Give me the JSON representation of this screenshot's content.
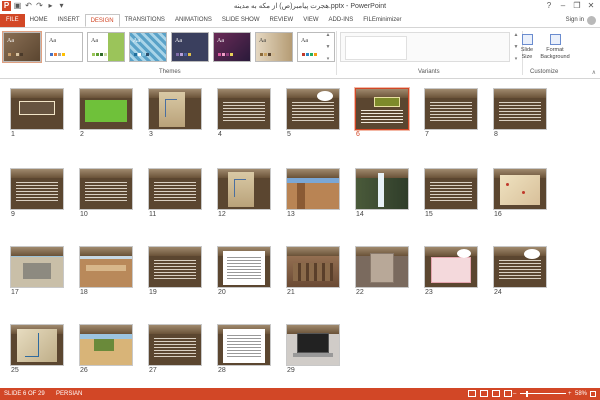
{
  "window": {
    "title": "هجرت پیامبر(ص) از مکه به مدینه.pptx - PowerPoint",
    "help_icon": "?",
    "minimize": "–",
    "restore": "❐",
    "close": "✕"
  },
  "qat": {
    "app_icon": "P",
    "save": "▣",
    "undo": "↶",
    "redo": "↷",
    "start": "▸",
    "customize": "▾"
  },
  "tabs": [
    "FILE",
    "HOME",
    "INSERT",
    "DESIGN",
    "TRANSITIONS",
    "ANIMATIONS",
    "SLIDE SHOW",
    "REVIEW",
    "VIEW",
    "ADD-INS",
    "FILEminimizer"
  ],
  "active_tab": "DESIGN",
  "sign_in": "Sign in",
  "ribbon": {
    "themes_label": "Themes",
    "variants_label": "Variants",
    "customize_label": "Customize",
    "slide_size": "Slide Size",
    "format_background": "Format Background",
    "scroll_up": "▲",
    "scroll_down": "▼",
    "more": "▾",
    "collapse": "∧",
    "theme_sample": "Aa"
  },
  "slides": [
    {
      "n": "1",
      "type": "title"
    },
    {
      "n": "2",
      "type": "green"
    },
    {
      "n": "3",
      "type": "map"
    },
    {
      "n": "4",
      "type": "text"
    },
    {
      "n": "5",
      "type": "bubble"
    },
    {
      "n": "6",
      "type": "textbox"
    },
    {
      "n": "7",
      "type": "text"
    },
    {
      "n": "8",
      "type": "text"
    },
    {
      "n": "9",
      "type": "text"
    },
    {
      "n": "10",
      "type": "text"
    },
    {
      "n": "11",
      "type": "text"
    },
    {
      "n": "12",
      "type": "map"
    },
    {
      "n": "13",
      "type": "photo-canyon"
    },
    {
      "n": "14",
      "type": "photo-waterfall"
    },
    {
      "n": "15",
      "type": "text"
    },
    {
      "n": "16",
      "type": "map2"
    },
    {
      "n": "17",
      "type": "photo-aerial"
    },
    {
      "n": "18",
      "type": "photo-rock"
    },
    {
      "n": "19",
      "type": "text"
    },
    {
      "n": "20",
      "type": "whitepage"
    },
    {
      "n": "21",
      "type": "photo-ruins"
    },
    {
      "n": "22",
      "type": "photo-stone"
    },
    {
      "n": "23",
      "type": "pinkbox"
    },
    {
      "n": "24",
      "type": "bubble"
    },
    {
      "n": "25",
      "type": "map3"
    },
    {
      "n": "26",
      "type": "photo-desert"
    },
    {
      "n": "27",
      "type": "text"
    },
    {
      "n": "28",
      "type": "whitepage"
    },
    {
      "n": "29",
      "type": "photo-laptop"
    }
  ],
  "selected_slide": "6",
  "status": {
    "slide_info": "SLIDE 6 OF 29",
    "language": "PERSIAN",
    "zoom_minus": "–",
    "zoom_plus": "+",
    "zoom": "58%"
  },
  "colors": {
    "accent": "#d24726",
    "slide_bg": "#5b4630"
  }
}
